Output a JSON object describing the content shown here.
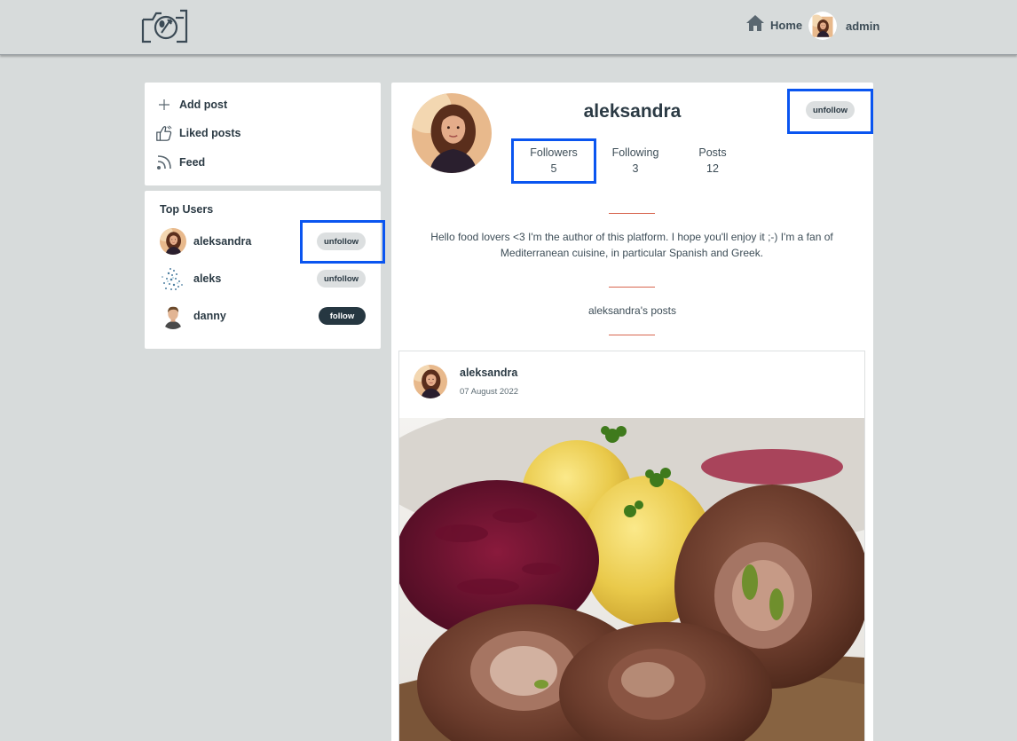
{
  "navbar": {
    "logo": "camera-fork-logo",
    "home_label": "Home",
    "user_label": "admin"
  },
  "menu": {
    "items": [
      {
        "label": "Add post",
        "icon": "plus-icon"
      },
      {
        "label": "Liked posts",
        "icon": "thumbs-up-icon"
      },
      {
        "label": "Feed",
        "icon": "rss-icon"
      }
    ]
  },
  "top_users": {
    "title": "Top Users",
    "users": [
      {
        "name": "aleksandra",
        "action": "unfollow"
      },
      {
        "name": "aleks",
        "action": "unfollow"
      },
      {
        "name": "danny",
        "action": "follow"
      }
    ]
  },
  "profile": {
    "name": "aleksandra",
    "action": "unfollow",
    "stats": {
      "followers_label": "Followers",
      "followers_value": "5",
      "following_label": "Following",
      "following_value": "3",
      "posts_label": "Posts",
      "posts_value": "12"
    },
    "bio": "Hello food lovers <3 I'm the author of this platform. I hope you'll enjoy it ;-) I'm a fan of Mediterranean cuisine, in particular Spanish and Greek.",
    "posts_title": "aleksandra's posts"
  },
  "post": {
    "author": "aleksandra",
    "date": "07 August 2022"
  },
  "colors": {
    "page_bg": "#d7dbdb",
    "text": "#2b3a44",
    "accent_divider": "#d8664f",
    "highlight": "#0a55f0",
    "follow_button": "#263741",
    "unfollow_button": "#dcdfe0"
  }
}
